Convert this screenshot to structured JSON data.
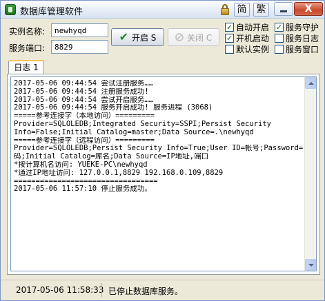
{
  "window": {
    "title": "数据库管理软件",
    "lang_buttons": [
      "简",
      "繁"
    ],
    "close_label": "X"
  },
  "form": {
    "instance_label": "实例名称:",
    "instance_value": "newhyqd",
    "port_label": "服务端口:",
    "port_value": "8829",
    "start_button": "开启 S",
    "stop_button": "关闭 C"
  },
  "options": [
    {
      "label": "自动开启",
      "checked": true
    },
    {
      "label": "服务守护",
      "checked": true
    },
    {
      "label": "开机启动",
      "checked": true
    },
    {
      "label": "服务日志",
      "checked": false
    },
    {
      "label": "默认实例",
      "checked": false
    },
    {
      "label": "服务窗口",
      "checked": false
    }
  ],
  "tabs": [
    {
      "label": "日志 1"
    }
  ],
  "log": [
    "2017-05-06 09:44:54 尝试注册服务……",
    "2017-05-06 09:44:54 注册服务成功!",
    "2017-05-06 09:44:54 尝试开启服务……",
    "2017-05-06 09:44:54 服务开启成功! 服务进程 (3068)",
    "=====参考连接字（本地访问）=========",
    "Provider=SQLOLEDB;Integrated Security=SSPI;Persist Security",
    "Info=False;Initial Catalog=master;Data Source=.\\newhyqd",
    "=====参考连接字（远程访问）=========",
    "Provider=SQLOLEDB;Persist Security Info=True;User ID=帐号;Password=密",
    "码;Initial Catalog=库名;Data Source=IP地址,端口",
    "*按计算机名访问: YUEKE-PC\\newhyqd",
    "*通过IP地址访问: 127.0.0.1,8829 192.168.0.109,8829",
    "=================================",
    "2017-05-06 11:57:10 停止服务成功。"
  ],
  "status": {
    "time": "2017-05-06 11:58:33",
    "message": "已停止数据库服务。"
  }
}
